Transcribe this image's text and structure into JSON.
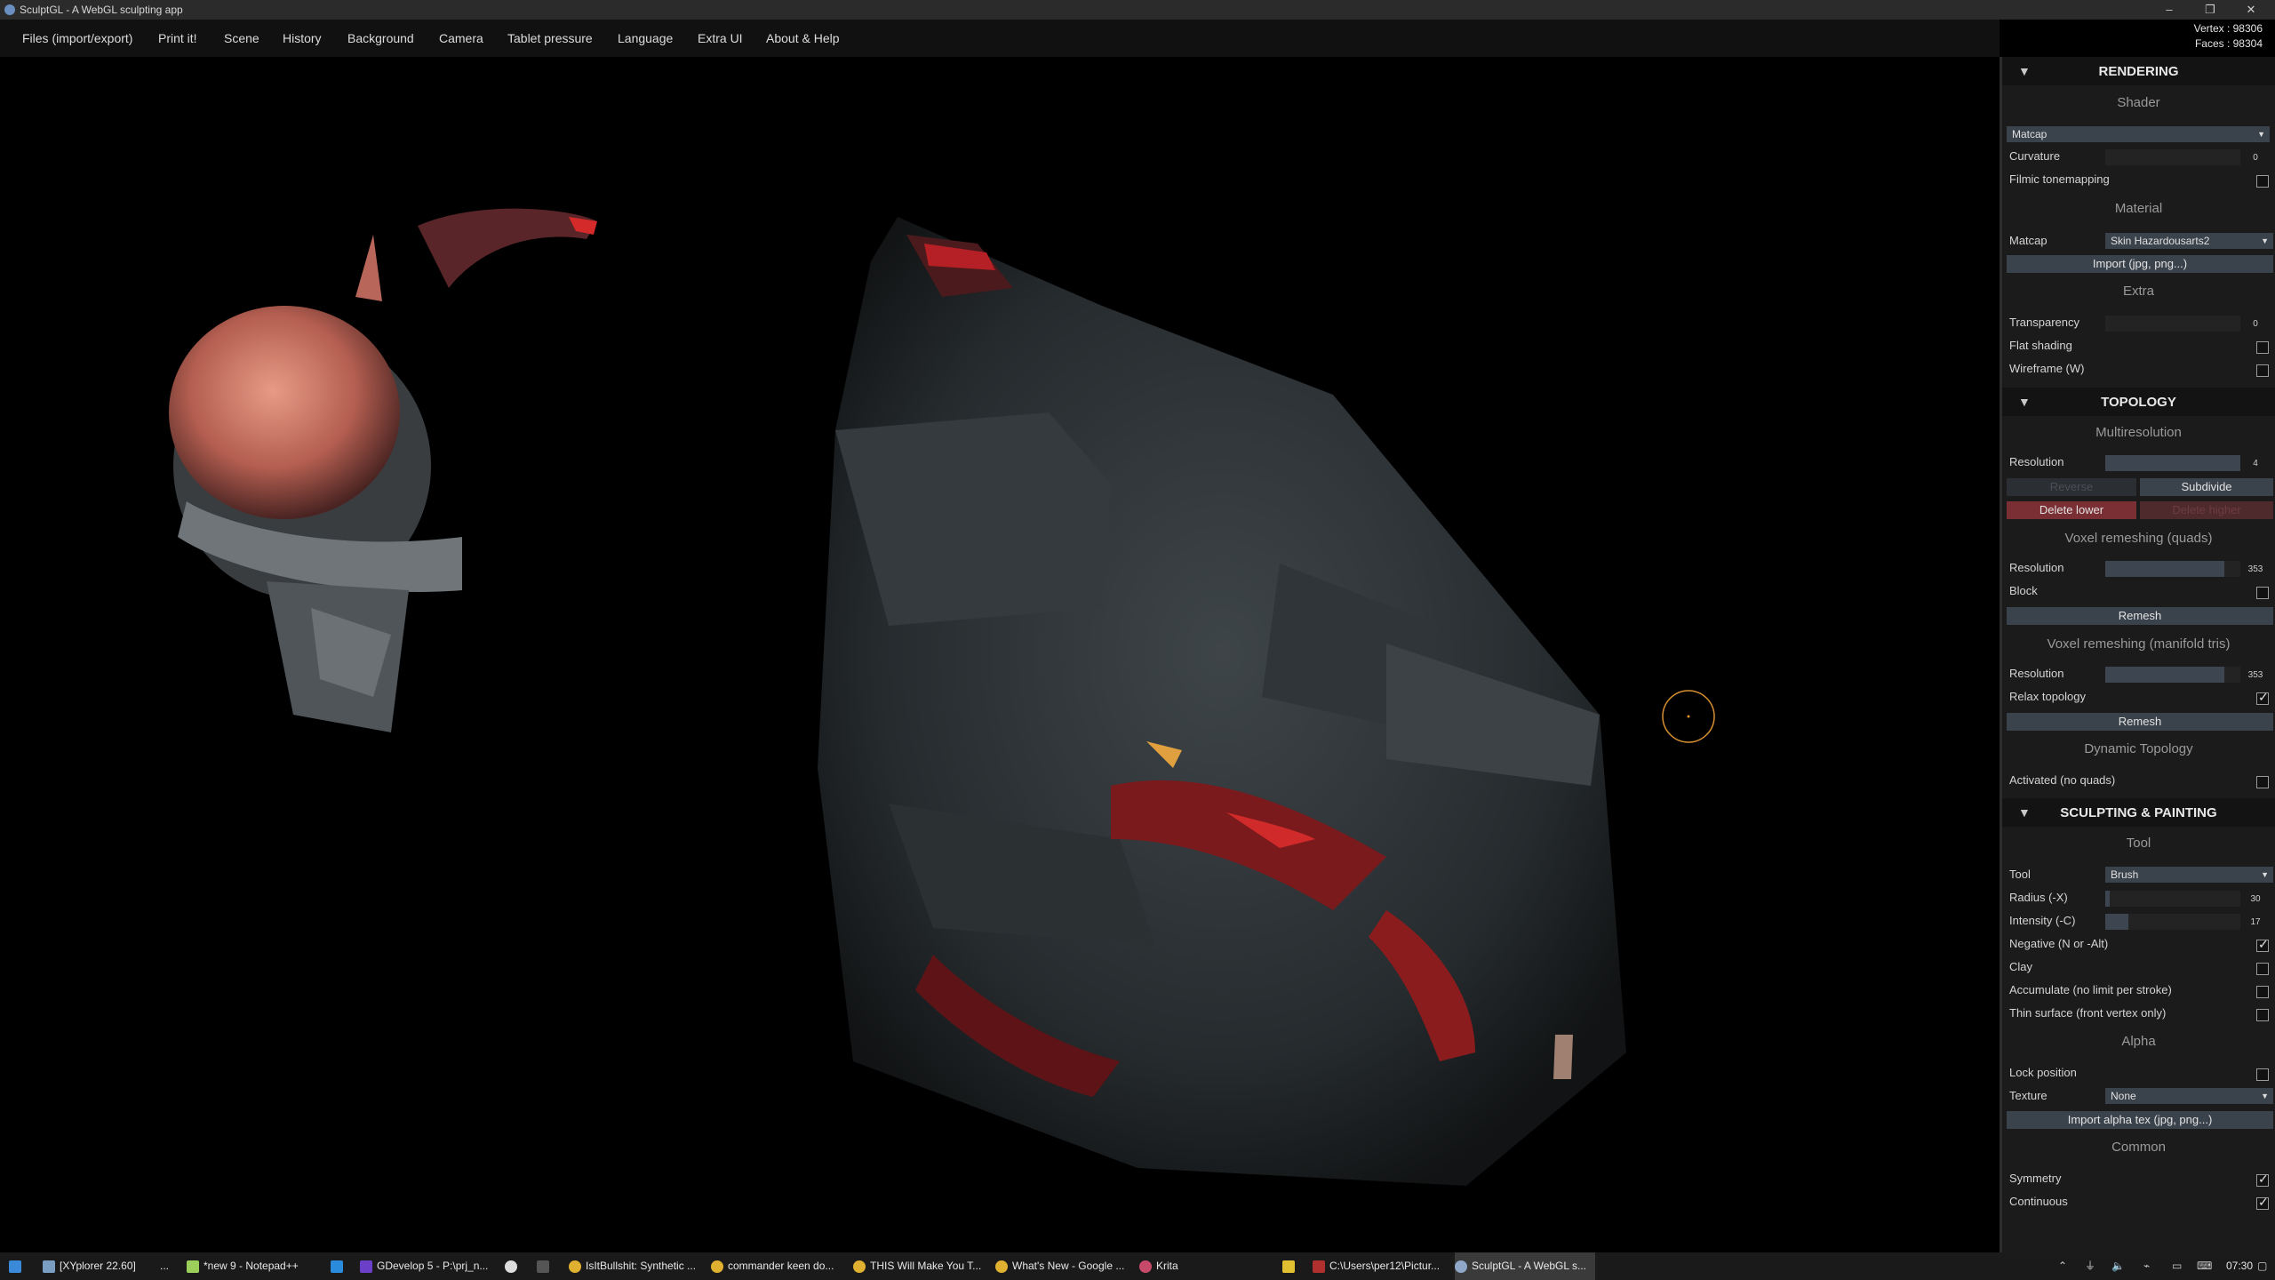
{
  "window": {
    "title": "SculptGL - A WebGL sculpting app",
    "controls": [
      "–",
      "❐",
      "✕"
    ]
  },
  "menu": [
    "Files (import/export)",
    "Print it!",
    "Scene",
    "History",
    "Background",
    "Camera",
    "Tablet pressure",
    "Language",
    "Extra UI",
    "About & Help"
  ],
  "stats": {
    "vertex": "Vertex : 98306",
    "faces": "Faces : 98304"
  },
  "panel": {
    "rendering": {
      "title": "RENDERING",
      "shader_sub": "Shader",
      "shader_value": "Matcap",
      "curvature_label": "Curvature",
      "curvature_value": "0",
      "filmic_label": "Filmic tonemapping",
      "material_sub": "Material",
      "matcap_label": "Matcap",
      "matcap_value": "Skin Hazardousarts2",
      "import_label": "Import (jpg, png...)",
      "extra_sub": "Extra",
      "transparency_label": "Transparency",
      "transparency_value": "0",
      "flat_label": "Flat shading",
      "wire_label": "Wireframe (W)"
    },
    "topology": {
      "title": "TOPOLOGY",
      "multires_sub": "Multiresolution",
      "res_label": "Resolution",
      "res_value": "4",
      "reverse_label": "Reverse",
      "subdivide_label": "Subdivide",
      "del_lower_label": "Delete lower",
      "del_higher_label": "Delete higher",
      "voxel_quads_sub": "Voxel remeshing (quads)",
      "vq_res_label": "Resolution",
      "vq_res_value": "353",
      "block_label": "Block",
      "remesh_label": "Remesh",
      "voxel_tris_sub": "Voxel remeshing (manifold tris)",
      "vt_res_label": "Resolution",
      "vt_res_value": "353",
      "relax_label": "Relax topology",
      "remesh2_label": "Remesh",
      "dyn_sub": "Dynamic Topology",
      "activated_label": "Activated (no quads)"
    },
    "sculpt": {
      "title": "SCULPTING & PAINTING",
      "tool_sub": "Tool",
      "tool_label": "Tool",
      "tool_value": "Brush",
      "radius_label": "Radius (-X)",
      "radius_value": "30",
      "intensity_label": "Intensity (-C)",
      "intensity_value": "17",
      "negative_label": "Negative (N or -Alt)",
      "clay_label": "Clay",
      "accumulate_label": "Accumulate (no limit per stroke)",
      "thin_label": "Thin surface (front vertex only)",
      "alpha_sub": "Alpha",
      "lock_label": "Lock position",
      "texture_label": "Texture",
      "texture_value": "None",
      "import_alpha_label": "Import alpha tex (jpg, png...)",
      "common_sub": "Common",
      "symmetry_label": "Symmetry",
      "continuous_label": "Continuous"
    }
  },
  "taskbar": {
    "items": [
      "[XYplorer 22.60]",
      "...",
      "*new 9 - Notepad++",
      "",
      "GDevelop 5 - P:\\prj_n...",
      "",
      "",
      "IsItBullshit: Synthetic ...",
      "commander keen do...",
      "THIS Will Make You T...",
      "What's New - Google ...",
      "Krita",
      "",
      "C:\\Users\\per12\\Pictur...",
      "SculptGL - A WebGL s..."
    ],
    "clock": "07:30"
  }
}
